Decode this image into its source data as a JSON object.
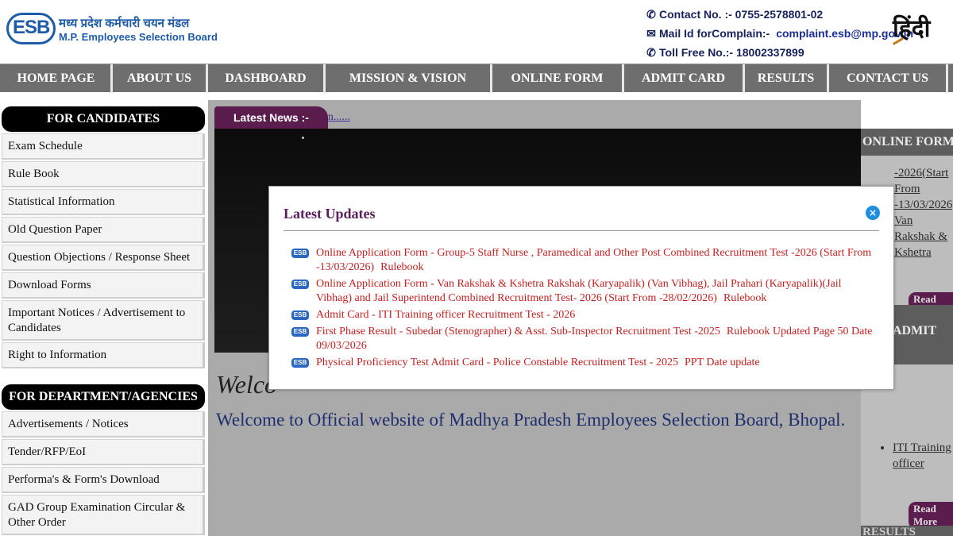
{
  "header": {
    "logo_letters": "ESB",
    "logo_hindi": "मध्य प्रदेश कर्मचारी चयन मंडल",
    "logo_english": "M.P. Employees Selection Board",
    "contact_line": "Contact No. :- 0755-2578801-02",
    "mail_label": "Mail Id forComplain:-",
    "mail_value": "complaint.esb@mp.gov.in",
    "tollfree_line": "Toll Free No.:- 18002337899",
    "lang_toggle": "हिंदी"
  },
  "nav": {
    "items": [
      "HOME PAGE",
      "ABOUT US",
      "DASHBOARD",
      "MISSION & VISION",
      "ONLINE FORM",
      "ADMIT CARD",
      "RESULTS",
      "CONTACT US"
    ]
  },
  "sidebar": {
    "candidates_title": "FOR CANDIDATES",
    "candidates": [
      "Exam Schedule",
      "Rule Book",
      "Statistical Information",
      "Old Question Paper",
      "Question Objections / Response Sheet",
      "Download Forms",
      "Important Notices / Advertisement to Candidates",
      "Right to Information"
    ],
    "department_title": "FOR DEPARTMENT/AGENCIES",
    "department": [
      "Advertisements / Notices",
      "Tender/RFP/EoI",
      "Performa's & Form's Download",
      "GAD Group Examination Circular & Other Order"
    ]
  },
  "main": {
    "news_label": "Latest News :-",
    "news_link": "n......",
    "welcome_script": "Welco",
    "welcome_text": "Welcome to Official website of Madhya Pradesh Employees Selection Board, Bhopal."
  },
  "right": {
    "online_form_title": "ONLINE FORM",
    "online_item_1": "-2026(Start From -13/03/2026)",
    "online_item_2": "Van Rakshak & Kshetra",
    "read_more": "Read More",
    "admit_title": "ADMIT",
    "admit_item": "ITI Training officer",
    "results_title": "RESULTS"
  },
  "modal": {
    "title": "Latest Updates",
    "close": "×",
    "badge": "ESB",
    "updates": [
      {
        "text": "Online Application Form - Group-5 Staff Nurse , Paramedical and Other Post Combined Recruitment Test -2026 (Start From -13/03/2026)",
        "extra": "Rulebook"
      },
      {
        "text": "Online Application Form - Van Rakshak & Kshetra Rakshak (Karyapalik) (Van Vibhag), Jail Prahari (Karyapalik)(Jail Vibhag) and Jail Superintend Combined Recruitment Test- 2026 (Start From -28/02/2026)",
        "extra": "Rulebook"
      },
      {
        "text": "Admit Card - ITI Training officer Recruitment Test - 2026",
        "extra": ""
      },
      {
        "text": "First Phase Result - Subedar (Stenographer) & Asst. Sub-Inspector Recruitment Test -2025",
        "extra": "Rulebook Updated Page 50 Date 09/03/2026"
      },
      {
        "text": "Physical Proficiency Test Admit Card - Police Constable Recruitment Test - 2025",
        "extra": "PPT Date update"
      }
    ]
  },
  "colors": {
    "brand_blue": "#1c5ca8",
    "nav_bg": "#6e6e6e",
    "accent_purple": "#5a1d4e",
    "update_red": "#c81e1e"
  }
}
